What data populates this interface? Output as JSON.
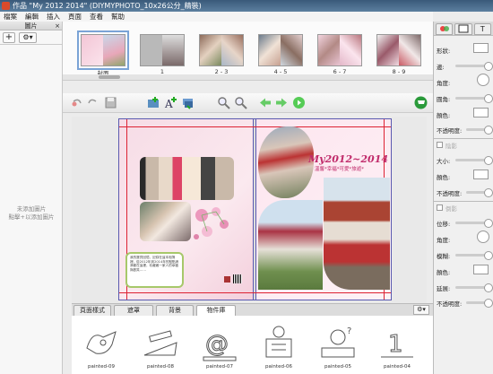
{
  "window": {
    "title": "作品 \"My 2012 2014\" (DIYMYPHOTO_10x26公分_精裝)"
  },
  "menu": [
    "檔案",
    "編輯",
    "插入",
    "頁面",
    "查看",
    "幫助"
  ],
  "left_panel": {
    "title": "圖片",
    "close": "×",
    "add": "+",
    "gear": "⚙▾",
    "empty_line1": "未添加圖片",
    "empty_line2": "點擊+以添加圖片"
  },
  "thumbnails": [
    {
      "label": "封面"
    },
    {
      "label": "1"
    },
    {
      "label": "2 - 3"
    },
    {
      "label": "4 - 5"
    },
    {
      "label": "6 - 7"
    },
    {
      "label": "8 - 9"
    }
  ],
  "page": {
    "headline": "My2012~2014",
    "subline": "溫馨*幸福*可愛*旅遊*",
    "note": "我的寶貝回憶，記錄在這本相簿裡，從2012年到2014年的點點滴滴都在這裡，珍藏著一家人的幸福與歡笑……"
  },
  "tabs": [
    "頁面樣式",
    "遮罩",
    "背景",
    "物件庫"
  ],
  "tab_gear": "⚙▾",
  "clipart": [
    {
      "label": "painted-09"
    },
    {
      "label": "painted-08"
    },
    {
      "label": "painted-07"
    },
    {
      "label": "painted-06"
    },
    {
      "label": "painted-05"
    },
    {
      "label": "painted-04"
    }
  ],
  "right_panel": {
    "tab_icons": [
      "palette-icon",
      "frame-icon",
      "text-icon"
    ],
    "tab_text": "T",
    "shape": "形狀:",
    "border": "邊:",
    "angle": "角度:",
    "corner": "圓角:",
    "color": "顏色:",
    "opacity": "不透明度:",
    "shadow_check": "陰影",
    "size": "大小:",
    "color2": "顏色:",
    "opacity2": "不透明度:",
    "reflect_check": "倒影",
    "offset": "位移:",
    "angle2": "角度:",
    "blur": "模糊:",
    "color3": "顏色:",
    "extend": "延展:",
    "opacity3": "不透明度:"
  },
  "colors": {
    "accent": "#c02a6a",
    "guide": "#dd2233",
    "page_border": "#5a5ab0"
  }
}
